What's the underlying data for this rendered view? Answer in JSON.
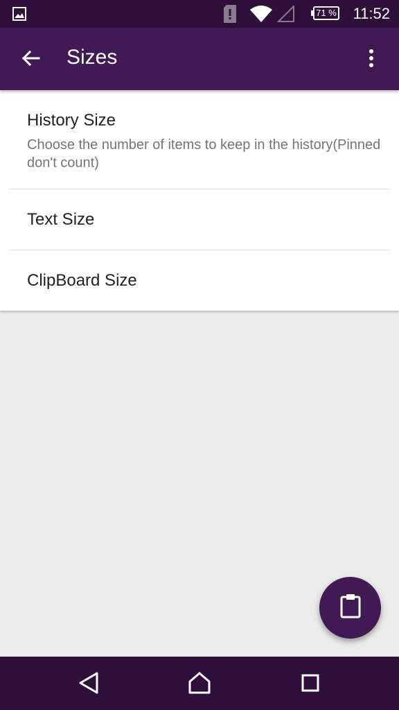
{
  "status_bar": {
    "time": "11:52",
    "battery_percent": "71 %",
    "icons": [
      "image-notification-icon",
      "alert-icon",
      "wifi-icon",
      "cell-signal-icon",
      "battery-icon"
    ]
  },
  "app_bar": {
    "title": "Sizes",
    "back_icon": "arrow-back-icon",
    "menu_icon": "more-vert-icon"
  },
  "settings": [
    {
      "title": "History Size",
      "summary": "Choose the number of items to keep in the history(Pinned don't count)"
    },
    {
      "title": "Text Size",
      "summary": ""
    },
    {
      "title": "ClipBoard Size",
      "summary": ""
    }
  ],
  "fab": {
    "icon": "clipboard-icon"
  },
  "nav_bar": {
    "icons": [
      "nav-back-icon",
      "nav-home-icon",
      "nav-recents-icon"
    ]
  },
  "colors": {
    "status_bar": "#2e0f3a",
    "app_bar": "#421a53",
    "background": "#ebebeb",
    "accent": "#421a53"
  }
}
